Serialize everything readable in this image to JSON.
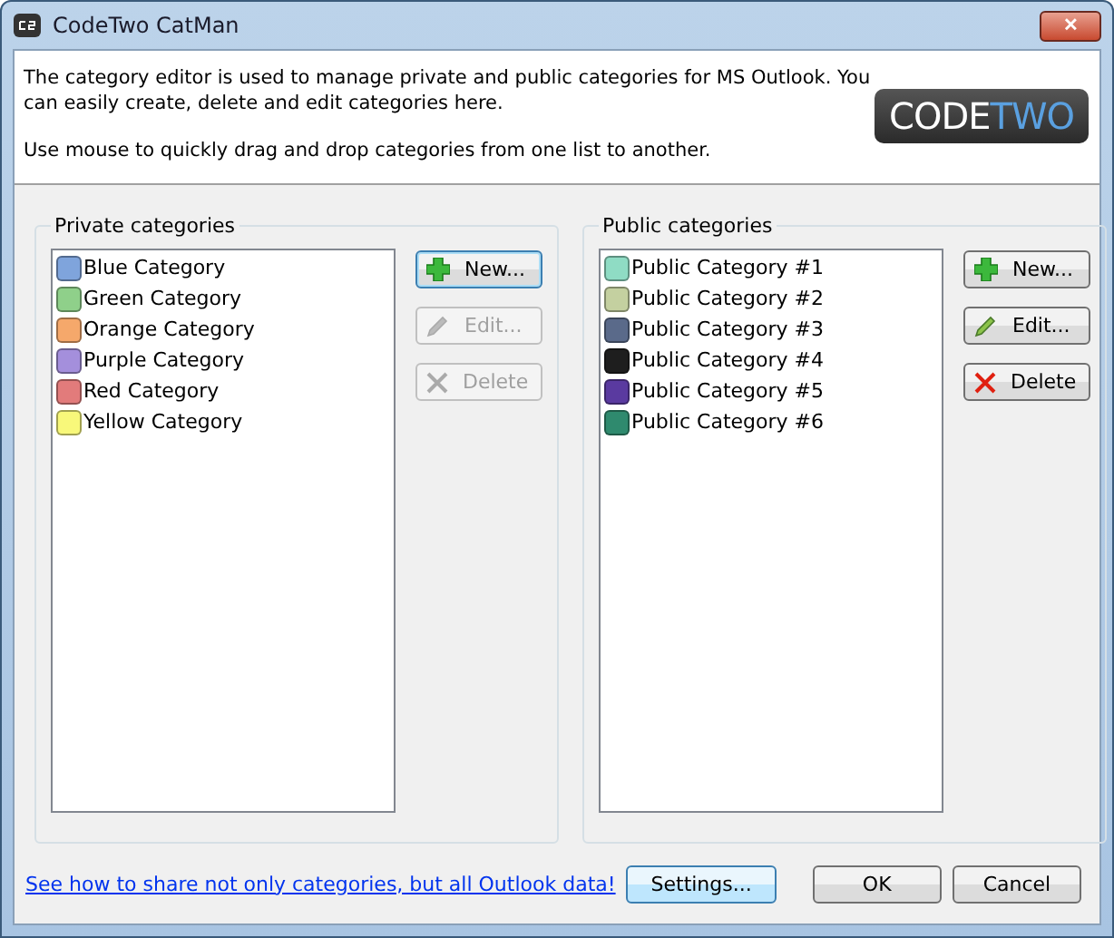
{
  "window": {
    "title": "CodeTwo CatMan",
    "close_label": "✕"
  },
  "header": {
    "description": "The category editor is used to manage private and public categories for MS Outlook. You can easily create, delete and edit categories here.",
    "hint": "Use mouse to quickly drag and drop categories from one list to another.",
    "logo": {
      "start": "CODE",
      "end": "TWO"
    }
  },
  "groups": [
    {
      "title": "Private categories",
      "items": [
        {
          "name": "Blue Category",
          "color": "#7fa4dc"
        },
        {
          "name": "Green Category",
          "color": "#8fd08a"
        },
        {
          "name": "Orange Category",
          "color": "#f5a86b"
        },
        {
          "name": "Purple Category",
          "color": "#a48fdc"
        },
        {
          "name": "Red Category",
          "color": "#e27b7b"
        },
        {
          "name": "Yellow Category",
          "color": "#f8f87a"
        }
      ],
      "buttons": [
        {
          "kind": "new",
          "label": "New...",
          "disabled": false,
          "focused": true
        },
        {
          "kind": "edit",
          "label": "Edit...",
          "disabled": true,
          "focused": false
        },
        {
          "kind": "delete",
          "label": "Delete",
          "disabled": true,
          "focused": false
        }
      ]
    },
    {
      "title": "Public categories",
      "items": [
        {
          "name": "Public Category #1",
          "color": "#8fdcc4"
        },
        {
          "name": "Public Category #2",
          "color": "#c4d0a0"
        },
        {
          "name": "Public Category #3",
          "color": "#5a6a8a"
        },
        {
          "name": "Public Category #4",
          "color": "#1e1e1e"
        },
        {
          "name": "Public Category #5",
          "color": "#5a3aa0"
        },
        {
          "name": "Public Category #6",
          "color": "#2f8a6e"
        }
      ],
      "buttons": [
        {
          "kind": "new",
          "label": "New...",
          "disabled": false,
          "focused": false
        },
        {
          "kind": "edit",
          "label": "Edit...",
          "disabled": false,
          "focused": false
        },
        {
          "kind": "delete",
          "label": "Delete",
          "disabled": false,
          "focused": false
        }
      ]
    }
  ],
  "footer": {
    "link": "See how to share not only categories, but all Outlook data!",
    "buttons": [
      {
        "label": "Settings...",
        "focused": true
      },
      {
        "label": "OK",
        "focused": false
      },
      {
        "label": "Cancel",
        "focused": false
      }
    ]
  }
}
